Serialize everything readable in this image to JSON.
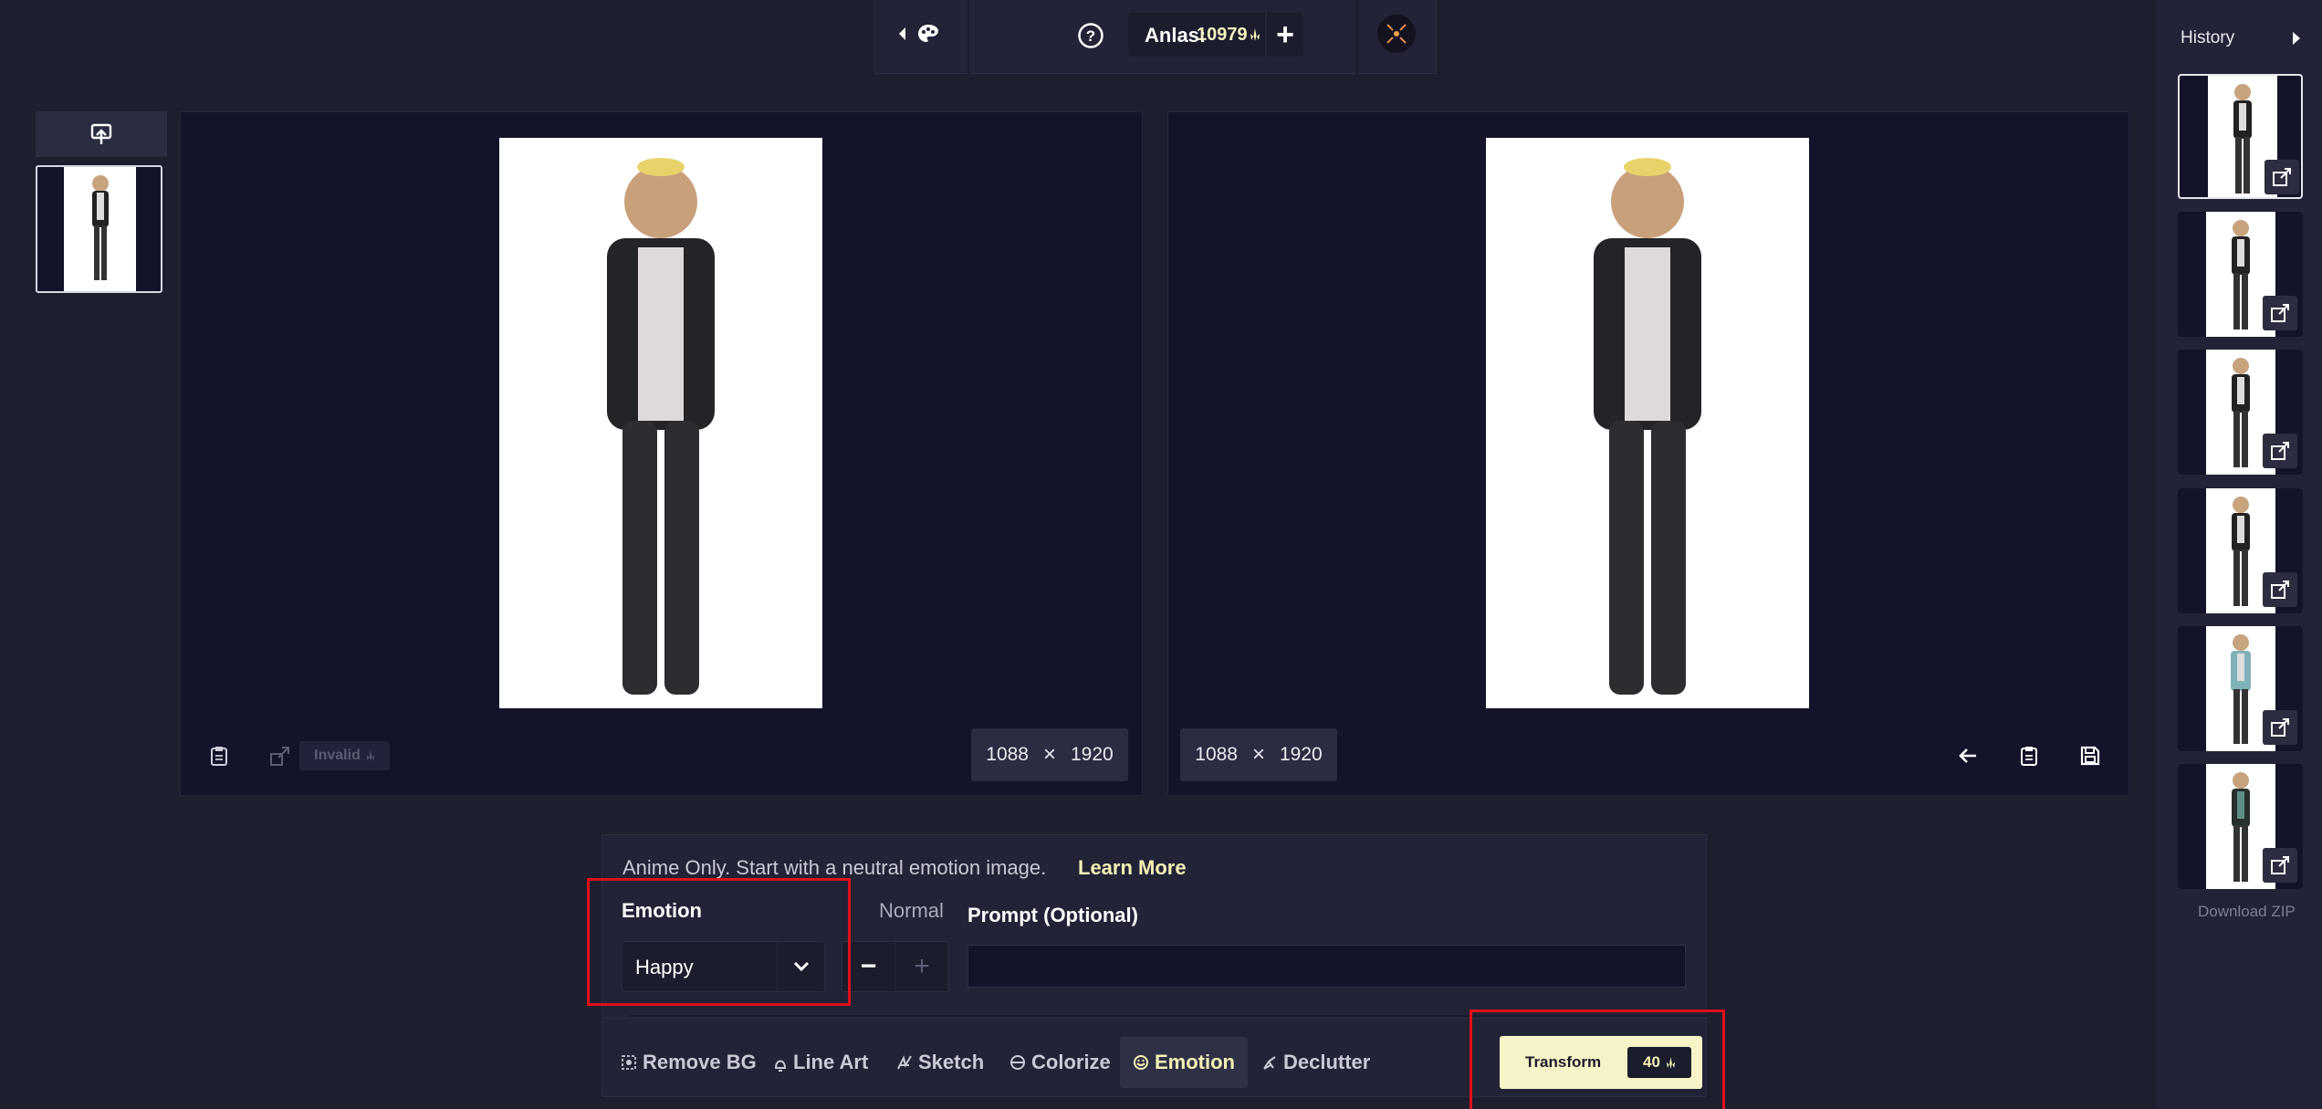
{
  "topbar": {
    "back_icon": "caret-left-icon",
    "palette_icon": "palette-icon",
    "help_icon": "help-circle-icon",
    "anlas_label": "Anlas:",
    "anlas_value": "10979",
    "add_icon": "plus-icon",
    "avatar_icon": "avatar-icon"
  },
  "left": {
    "upload_icon": "upload-icon"
  },
  "source_panel": {
    "width": "1088",
    "height": "1920",
    "times": "×",
    "invalid_label": "Invalid",
    "clipboard_icon": "clipboard-icon",
    "upscale_icon": "upscale-icon"
  },
  "result_panel": {
    "width": "1088",
    "height": "1920",
    "times": "×",
    "back_icon": "arrow-left-icon",
    "clipboard_icon": "clipboard-icon",
    "save_icon": "save-icon"
  },
  "tool": {
    "hint": "Anime Only. Start with a neutral emotion image.",
    "learn_more": "Learn More",
    "emotion_label": "Emotion",
    "emotion_value": "Happy",
    "strength_label": "Normal",
    "minus": "−",
    "plus": "+",
    "prompt_label": "Prompt (Optional)",
    "prompt_value": ""
  },
  "tabs": [
    {
      "label": "Remove BG",
      "icon": "remove-bg-icon"
    },
    {
      "label": "Line Art",
      "icon": "line-art-icon"
    },
    {
      "label": "Sketch",
      "icon": "sketch-icon"
    },
    {
      "label": "Colorize",
      "icon": "colorize-icon"
    },
    {
      "label": "Emotion",
      "icon": "emotion-icon",
      "active": true
    },
    {
      "label": "Declutter",
      "icon": "declutter-icon"
    }
  ],
  "transform": {
    "label": "Transform",
    "cost": "40"
  },
  "history": {
    "title": "History",
    "download": "Download ZIP",
    "items_count_visible": 6
  },
  "colors": {
    "background": "#1d1e2e",
    "panel": "#13142a",
    "accent": "#f6f2b5",
    "highlight_box": "#e0101a"
  }
}
